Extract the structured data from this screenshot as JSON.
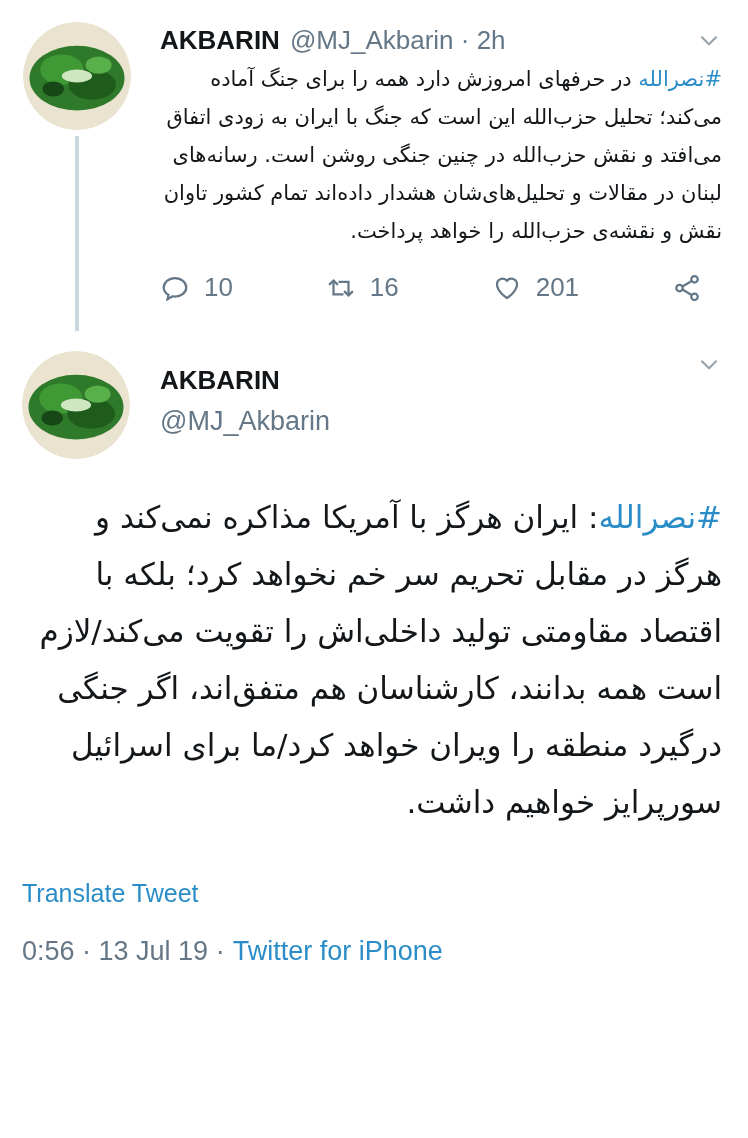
{
  "tweets": [
    {
      "kind": "reply",
      "name": "AKBARIN",
      "meta": "@MJ_Akbarin · 2h",
      "hashtag": "#نصرالله",
      "text": " در حرفهای امروزش دارد همه را برای جنگ آماده می‌کند؛ تحلیل حزب‌الله این است که جنگ با ایران به زودی اتفاق می‌افتد و نقش حزب‌الله در چنین جنگی روشن است. رسانه‌های لبنان در مقالات و تحلیل‌های‌شان هشدار داده‌اند تمام کشور تاوان نقش و نقشه‌ی حزب‌الله را خواهد پرداخت.",
      "replies": "10",
      "retweets": "16",
      "likes": "201"
    },
    {
      "kind": "main",
      "name": "AKBARIN",
      "meta": "@MJ_Akbarin",
      "hashtag": "#نصرالله",
      "text": ": ایران هرگز با آمریکا مذاکره نمی‌کند و هرگز در مقابل تحریم سر خم نخواهد کرد؛ بلکه با اقتصاد مقاومتی تولید داخلی‌اش را تقویت می‌کند/لازم است همه بدانند، کارشناسان هم متفق‌اند، اگر جنگی درگیرد منطقه را ویران خواهد کرد/ما برای اسرائیل سورپرایز خواهیم داشت.",
      "translate": "Translate Tweet",
      "timestamp": "0:56 · 13 Jul 19 ·",
      "source": "Twitter for iPhone"
    }
  ]
}
